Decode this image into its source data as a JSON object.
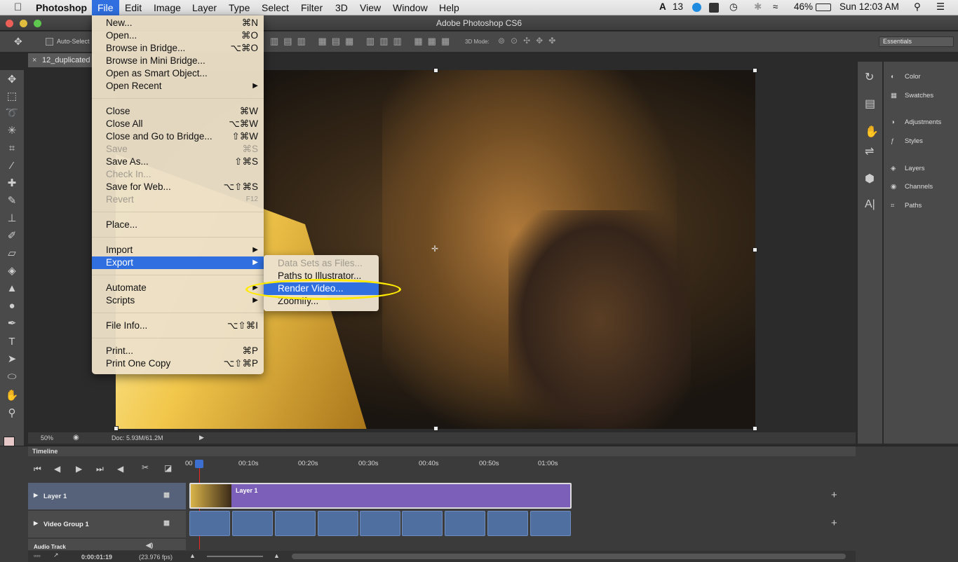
{
  "menubar": {
    "app": "Photoshop",
    "items": [
      "File",
      "Edit",
      "Image",
      "Layer",
      "Type",
      "Select",
      "Filter",
      "3D",
      "View",
      "Window",
      "Help"
    ],
    "status": {
      "adobe": "13",
      "battery": "46%",
      "clock": "Sun 12:03 AM"
    }
  },
  "window": {
    "title": "Adobe Photoshop CS6"
  },
  "options": {
    "auto_select": "Auto-Select",
    "mode3d": "3D Mode:",
    "workspace": "Essentials"
  },
  "document": {
    "tab": "12_duplicated"
  },
  "statusbar": {
    "zoom": "50%",
    "doc": "Doc: 5.93M/61.2M"
  },
  "panels": {
    "items": [
      "Color",
      "Swatches",
      "Adjustments",
      "Styles",
      "Layers",
      "Channels",
      "Paths"
    ]
  },
  "file_menu": {
    "items": [
      {
        "label": "New...",
        "shortcut": "⌘N",
        "disabled": false
      },
      {
        "label": "Open...",
        "shortcut": "⌘O",
        "disabled": false
      },
      {
        "label": "Browse in Bridge...",
        "shortcut": "⌥⌘O",
        "disabled": false
      },
      {
        "label": "Browse in Mini Bridge...",
        "shortcut": "",
        "disabled": false
      },
      {
        "label": "Open as Smart Object...",
        "shortcut": "",
        "disabled": false
      },
      {
        "label": "Open Recent",
        "shortcut": "▶",
        "disabled": false
      },
      {
        "label": "Close",
        "shortcut": "⌘W",
        "disabled": false
      },
      {
        "label": "Close All",
        "shortcut": "⌥⌘W",
        "disabled": false
      },
      {
        "label": "Close and Go to Bridge...",
        "shortcut": "⇧⌘W",
        "disabled": false
      },
      {
        "label": "Save",
        "shortcut": "⌘S",
        "disabled": true
      },
      {
        "label": "Save As...",
        "shortcut": "⇧⌘S",
        "disabled": false
      },
      {
        "label": "Check In...",
        "shortcut": "",
        "disabled": true
      },
      {
        "label": "Save for Web...",
        "shortcut": "⌥⇧⌘S",
        "disabled": false
      },
      {
        "label": "Revert",
        "shortcut": "F12",
        "disabled": true
      },
      {
        "label": "Place...",
        "shortcut": "",
        "disabled": false
      },
      {
        "label": "Import",
        "shortcut": "▶",
        "disabled": false
      },
      {
        "label": "Export",
        "shortcut": "▶",
        "disabled": false
      },
      {
        "label": "Automate",
        "shortcut": "▶",
        "disabled": false
      },
      {
        "label": "Scripts",
        "shortcut": "▶",
        "disabled": false
      },
      {
        "label": "File Info...",
        "shortcut": "⌥⇧⌘I",
        "disabled": false
      },
      {
        "label": "Print...",
        "shortcut": "⌘P",
        "disabled": false
      },
      {
        "label": "Print One Copy",
        "shortcut": "⌥⇧⌘P",
        "disabled": false
      }
    ]
  },
  "export_submenu": {
    "items": [
      {
        "label": "Data Sets as Files...",
        "disabled": true
      },
      {
        "label": "Paths to Illustrator...",
        "disabled": false
      },
      {
        "label": "Render Video...",
        "disabled": false
      },
      {
        "label": "Zoomify...",
        "disabled": false
      }
    ]
  },
  "timeline": {
    "title": "Timeline",
    "ticks": [
      "00",
      "00:10s",
      "00:20s",
      "00:30s",
      "00:40s",
      "00:50s",
      "01:00s"
    ],
    "tracks": [
      "Layer 1",
      "Video Group 1",
      "Audio Track"
    ],
    "clip_label": "Layer 1",
    "timecode": "0:00:01:19",
    "fps": "(23.976 fps)"
  }
}
